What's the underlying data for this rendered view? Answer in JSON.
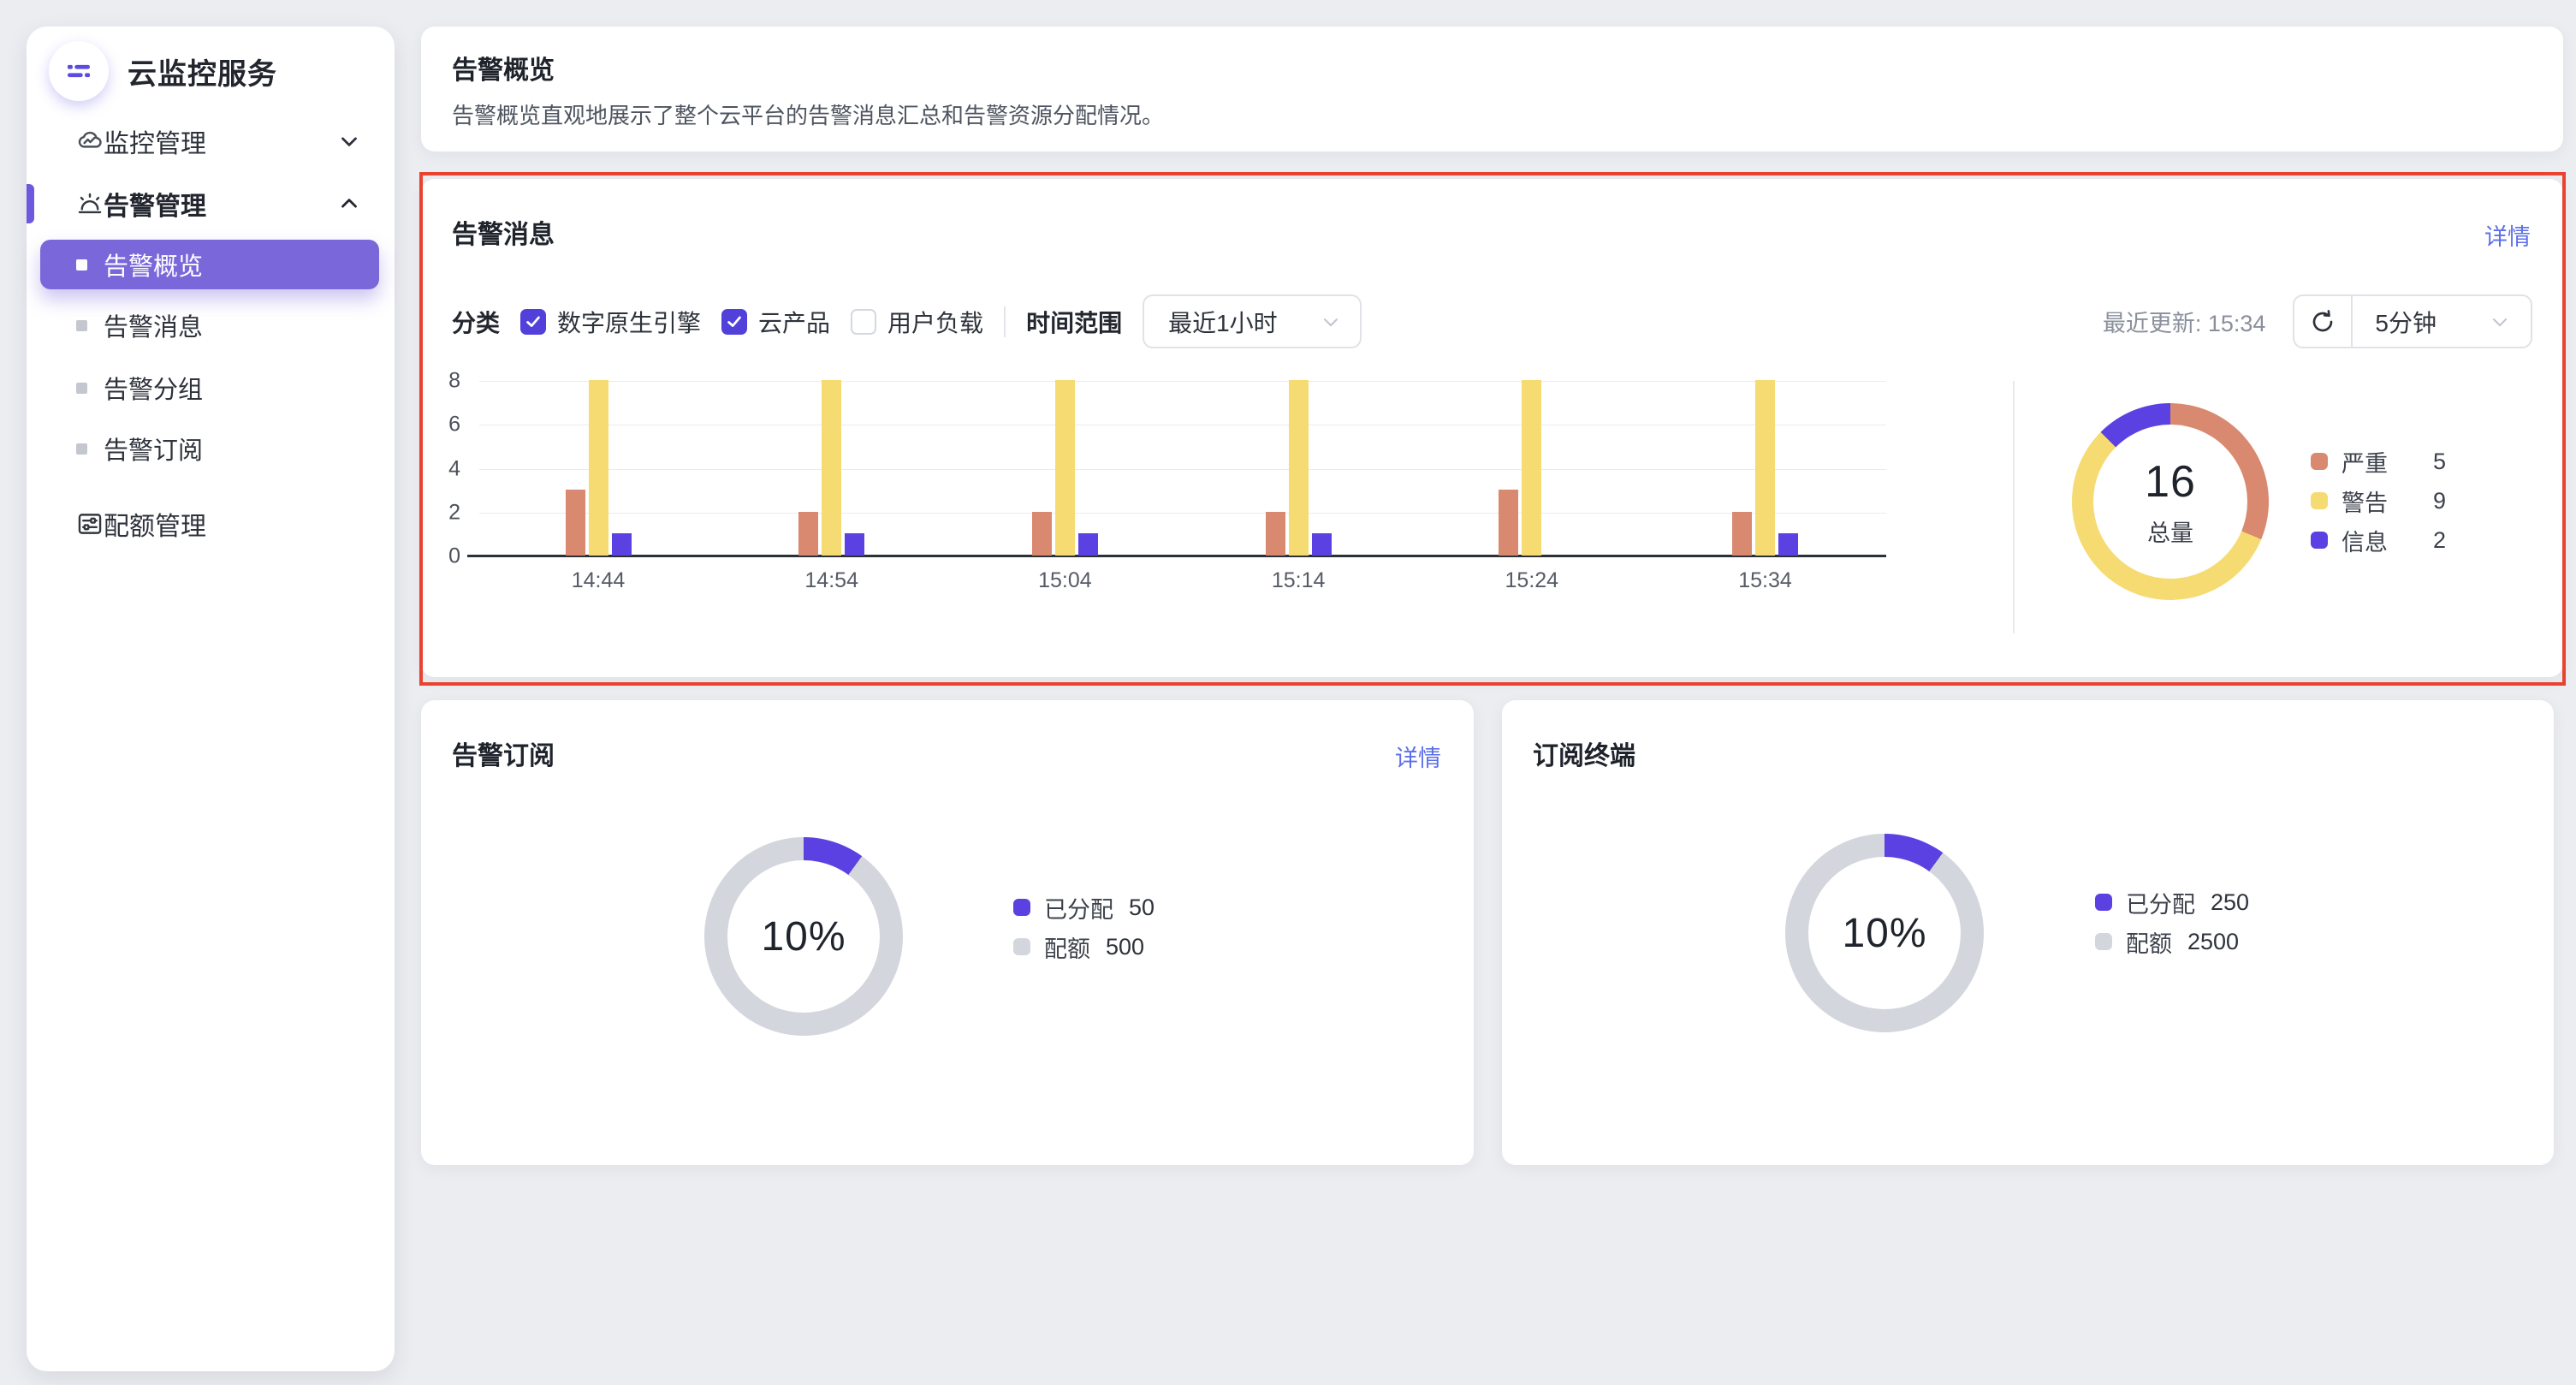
{
  "sidebar": {
    "title": "云监控服务",
    "sections": [
      {
        "label": "监控管理",
        "state": "collapsed"
      },
      {
        "label": "告警管理",
        "state": "expanded"
      },
      {
        "label": "配额管理"
      }
    ],
    "submenu": [
      {
        "label": "告警概览",
        "selected": true
      },
      {
        "label": "告警消息",
        "selected": false
      },
      {
        "label": "告警分组",
        "selected": false
      },
      {
        "label": "告警订阅",
        "selected": false
      }
    ]
  },
  "overview_card": {
    "title": "告警概览",
    "description": "告警概览直观地展示了整个云平台的告警消息汇总和告警资源分配情况。"
  },
  "alert_card": {
    "title": "告警消息",
    "detail_link": "详情",
    "filters": {
      "category_label": "分类",
      "options": [
        {
          "label": "数字原生引擎",
          "checked": true
        },
        {
          "label": "云产品",
          "checked": true
        },
        {
          "label": "用户负载",
          "checked": false
        }
      ],
      "time_label": "时间范围",
      "time_value": "最近1小时",
      "last_update": "最近更新: 15:34",
      "refresh_interval": "5分钟"
    }
  },
  "subscription_card": {
    "title": "告警订阅",
    "detail_link": "详情"
  },
  "terminal_card": {
    "title": "订阅终端"
  },
  "colors": {
    "accent_purple": "#7A68DB",
    "deep_purple": "#5B41E2",
    "severe_salmon": "#D9896F",
    "warning_yellow": "#F5DB72",
    "quota_gray": "#D3D6DD",
    "highlight_red": "#E94230",
    "link_blue": "#5C6FE8"
  },
  "chart_data": [
    {
      "type": "bar",
      "title": "告警消息",
      "x": [
        "14:44",
        "14:54",
        "15:04",
        "15:14",
        "15:24",
        "15:34"
      ],
      "series": [
        {
          "name": "严重",
          "color": "#D9896F",
          "values": [
            3,
            2,
            2,
            2,
            3,
            2
          ]
        },
        {
          "name": "警告",
          "color": "#F5DB72",
          "values": [
            8,
            8,
            8,
            8,
            8,
            8
          ]
        },
        {
          "name": "信息",
          "color": "#5B41E2",
          "values": [
            1,
            1,
            1,
            1,
            0,
            1
          ]
        }
      ],
      "xlabel": "",
      "ylabel": "",
      "ylim": [
        0,
        8
      ],
      "yticks": [
        0,
        2,
        4,
        6,
        8
      ],
      "grid": true,
      "legend_position": "right-donut"
    },
    {
      "type": "donut",
      "title": "告警消息总量",
      "center_value": "16",
      "center_label": "总量",
      "donut_mode": "sum",
      "slices": [
        {
          "label": "严重",
          "value": 5,
          "color": "#D9896F"
        },
        {
          "label": "警告",
          "value": 9,
          "color": "#F5DB72"
        },
        {
          "label": "信息",
          "value": 2,
          "color": "#5B41E2"
        }
      ],
      "legend_position": "right"
    },
    {
      "type": "donut",
      "title": "告警订阅",
      "center_value": "10%",
      "center_label": "",
      "donut_mode": "ratio",
      "slices": [
        {
          "label": "已分配",
          "value": 50,
          "color": "#5B41E2"
        },
        {
          "label": "配额",
          "value": 500,
          "color": "#D3D6DD"
        }
      ],
      "legend_position": "right"
    },
    {
      "type": "donut",
      "title": "订阅终端",
      "center_value": "10%",
      "center_label": "",
      "donut_mode": "ratio",
      "slices": [
        {
          "label": "已分配",
          "value": 250,
          "color": "#5B41E2"
        },
        {
          "label": "配额",
          "value": 2500,
          "color": "#D3D6DD"
        }
      ],
      "legend_position": "right"
    }
  ]
}
